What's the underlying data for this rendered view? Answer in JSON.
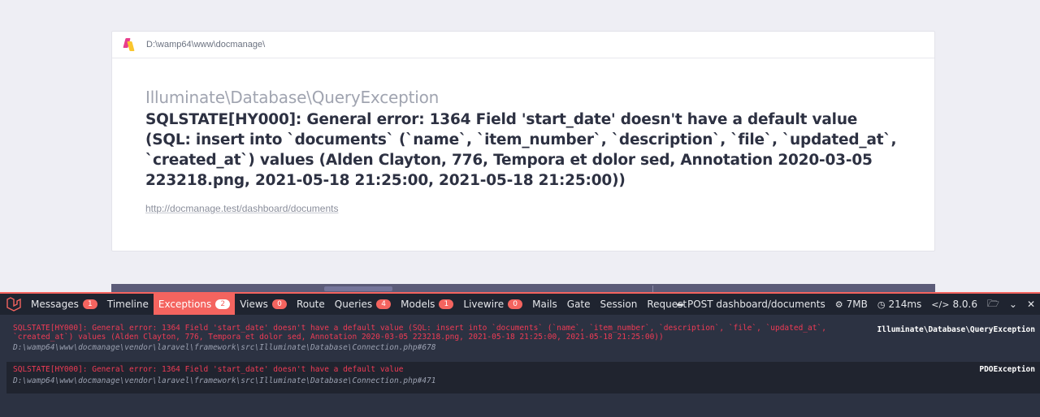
{
  "card": {
    "path": "D:\\wamp64\\www\\docmanage\\",
    "exception_class": "Illuminate\\Database\\QueryException",
    "message": "SQLSTATE[HY000]: General error: 1364 Field 'start_date' doesn't have a default value (SQL: insert into `documents` (`name`, `item_number`, `description`, `file`, `updated_at`, `created_at`) values (Alden Clayton, 776, Tempora et dolor sed, Annotation 2020-03-05 223218.png, 2021-05-18 21:25:00, 2021-05-18 21:25:00))",
    "url": "http://docmanage.test/dashboard/documents"
  },
  "debugbar": {
    "tabs": [
      {
        "label": "Messages",
        "badge": "1"
      },
      {
        "label": "Timeline",
        "badge": null
      },
      {
        "label": "Exceptions",
        "badge": "2",
        "active": true
      },
      {
        "label": "Views",
        "badge": "0"
      },
      {
        "label": "Route",
        "badge": null
      },
      {
        "label": "Queries",
        "badge": "4"
      },
      {
        "label": "Models",
        "badge": "1"
      },
      {
        "label": "Livewire",
        "badge": "0"
      },
      {
        "label": "Mails",
        "badge": null
      },
      {
        "label": "Gate",
        "badge": null
      },
      {
        "label": "Session",
        "badge": null
      },
      {
        "label": "Request",
        "badge": null
      }
    ],
    "request": "POST dashboard/documents",
    "memory": "7MB",
    "time": "214ms",
    "php_version": "8.0.6",
    "exceptions": [
      {
        "message": "SQLSTATE[HY000]: General error: 1364 Field 'start_date' doesn't have a default value (SQL: insert into `documents` (`name`, `item_number`, `description`, `file`, `updated_at`, `created_at`) values (Alden Clayton, 776, Tempora et dolor sed, Annotation 2020-03-05 223218.png, 2021-05-18 21:25:00, 2021-05-18 21:25:00))",
        "file": "D:\\wamp64\\www\\docmanage\\vendor\\laravel\\framework\\src\\Illuminate\\Database\\Connection.php#678",
        "class": "Illuminate\\Database\\QueryException"
      },
      {
        "message": "SQLSTATE[HY000]: General error: 1364 Field 'start_date' doesn't have a default value",
        "file": "D:\\wamp64\\www\\docmanage\\vendor\\laravel\\framework\\src\\Illuminate\\Database\\Connection.php#471",
        "class": "PDOException"
      }
    ]
  },
  "colors": {
    "accent": "#f4645f",
    "error_text": "#ef3b55",
    "debugbar_bg": "#2c3242"
  }
}
